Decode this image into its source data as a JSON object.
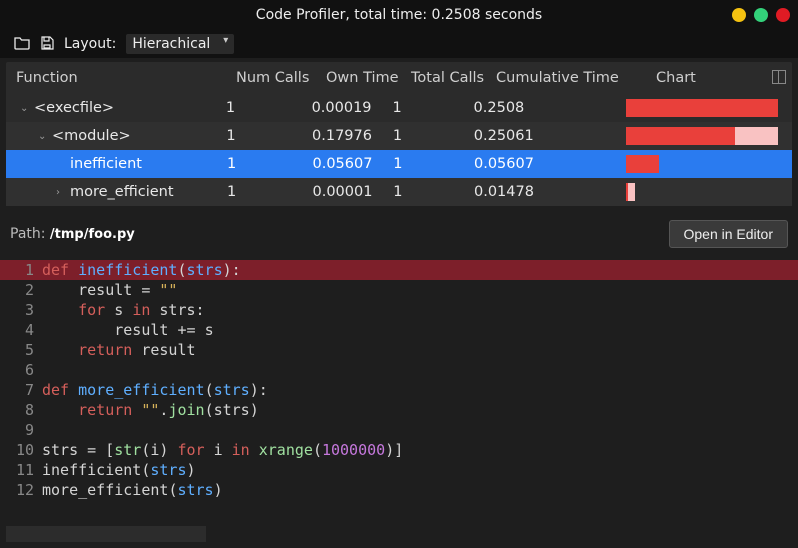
{
  "titlebar": {
    "title": "Code Profiler, total time: 0.2508 seconds"
  },
  "toolbar": {
    "layout_label": "Layout:",
    "layout_value": "Hierachical"
  },
  "table": {
    "headers": {
      "function": "Function",
      "num_calls": "Num Calls",
      "own_time": "Own Time",
      "total_calls": "Total Calls",
      "cumulative": "Cumulative Time",
      "chart": "Chart"
    },
    "rows": [
      {
        "indent": 0,
        "expander": "⌄",
        "name": "<execfile>",
        "num_calls": "1",
        "own_time": "0.00019",
        "total_calls": "1",
        "cumulative": "0.2508",
        "bg_pct": 100,
        "fg_pct": 100,
        "selected": false,
        "alt": false
      },
      {
        "indent": 1,
        "expander": "⌄",
        "name": "<module>",
        "num_calls": "1",
        "own_time": "0.17976",
        "total_calls": "1",
        "cumulative": "0.25061",
        "bg_pct": 100,
        "fg_pct": 72,
        "selected": false,
        "alt": true
      },
      {
        "indent": 2,
        "expander": "",
        "name": "inefficient",
        "num_calls": "1",
        "own_time": "0.05607",
        "total_calls": "1",
        "cumulative": "0.05607",
        "bg_pct": 22,
        "fg_pct": 22,
        "selected": true,
        "alt": false
      },
      {
        "indent": 2,
        "expander": "›",
        "name": "more_efficient",
        "num_calls": "1",
        "own_time": "0.00001",
        "total_calls": "1",
        "cumulative": "0.01478",
        "bg_pct": 6,
        "fg_pct": 1,
        "selected": false,
        "alt": true
      }
    ]
  },
  "path": {
    "label": "Path: ",
    "value": "/tmp/foo.py",
    "open_button": "Open in Editor"
  },
  "code": {
    "highlight_line": 1,
    "lines": [
      [
        {
          "t": "def ",
          "c": "kw"
        },
        {
          "t": "inefficient",
          "c": "fn"
        },
        {
          "t": "(",
          "c": "pn"
        },
        {
          "t": "strs",
          "c": "fn"
        },
        {
          "t": "):",
          "c": "pn"
        }
      ],
      [
        {
          "t": "    result ",
          "c": "st"
        },
        {
          "t": "= ",
          "c": "pn"
        },
        {
          "t": "\"\"",
          "c": "str"
        }
      ],
      [
        {
          "t": "    ",
          "c": "st"
        },
        {
          "t": "for ",
          "c": "kw"
        },
        {
          "t": "s ",
          "c": "st"
        },
        {
          "t": "in ",
          "c": "kw"
        },
        {
          "t": "strs:",
          "c": "st"
        }
      ],
      [
        {
          "t": "        result ",
          "c": "st"
        },
        {
          "t": "+= ",
          "c": "pn"
        },
        {
          "t": "s",
          "c": "st"
        }
      ],
      [
        {
          "t": "    ",
          "c": "st"
        },
        {
          "t": "return ",
          "c": "kw"
        },
        {
          "t": "result",
          "c": "st"
        }
      ],
      [
        {
          "t": "",
          "c": "st"
        }
      ],
      [
        {
          "t": "def ",
          "c": "kw"
        },
        {
          "t": "more_efficient",
          "c": "fn"
        },
        {
          "t": "(",
          "c": "pn"
        },
        {
          "t": "strs",
          "c": "fn"
        },
        {
          "t": "):",
          "c": "pn"
        }
      ],
      [
        {
          "t": "    ",
          "c": "st"
        },
        {
          "t": "return ",
          "c": "kw"
        },
        {
          "t": "\"\"",
          "c": "str"
        },
        {
          "t": ".",
          "c": "pn"
        },
        {
          "t": "join",
          "c": "op"
        },
        {
          "t": "(",
          "c": "pn"
        },
        {
          "t": "strs",
          "c": "st"
        },
        {
          "t": ")",
          "c": "pn"
        }
      ],
      [
        {
          "t": "",
          "c": "st"
        }
      ],
      [
        {
          "t": "strs ",
          "c": "st"
        },
        {
          "t": "= ",
          "c": "pn"
        },
        {
          "t": "[",
          "c": "pn"
        },
        {
          "t": "str",
          "c": "op"
        },
        {
          "t": "(",
          "c": "pn"
        },
        {
          "t": "i",
          "c": "st"
        },
        {
          "t": ") ",
          "c": "pn"
        },
        {
          "t": "for ",
          "c": "kw"
        },
        {
          "t": "i ",
          "c": "st"
        },
        {
          "t": "in ",
          "c": "kw"
        },
        {
          "t": "xrange",
          "c": "op"
        },
        {
          "t": "(",
          "c": "pn"
        },
        {
          "t": "1000000",
          "c": "num"
        },
        {
          "t": ")]",
          "c": "pn"
        }
      ],
      [
        {
          "t": "inefficient",
          "c": "st"
        },
        {
          "t": "(",
          "c": "pn"
        },
        {
          "t": "strs",
          "c": "fn"
        },
        {
          "t": ")",
          "c": "pn"
        }
      ],
      [
        {
          "t": "more_efficient",
          "c": "st"
        },
        {
          "t": "(",
          "c": "pn"
        },
        {
          "t": "strs",
          "c": "fn"
        },
        {
          "t": ")",
          "c": "pn"
        }
      ]
    ]
  }
}
